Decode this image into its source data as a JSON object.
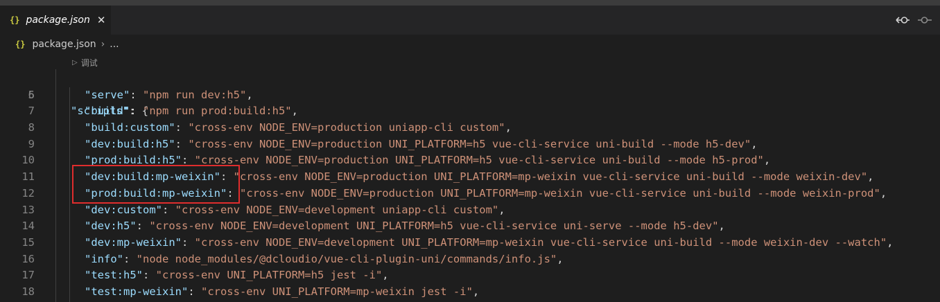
{
  "tab": {
    "icon_text": "{}",
    "title": "package.json",
    "close": "✕"
  },
  "breadcrumb": {
    "icon_text": "{}",
    "file": "package.json",
    "separator": "›",
    "ellipsis": "..."
  },
  "codelens": {
    "arrow": "▷",
    "label": "调试"
  },
  "code": {
    "scripts_line": {
      "number": "5",
      "key": "\"scripts\"",
      "rest": ": {"
    },
    "entries": [
      {
        "number": "6",
        "key": "\"serve\"",
        "value": "\"npm run dev:h5\""
      },
      {
        "number": "7",
        "key": "\"build\"",
        "value": "\"npm run prod:build:h5\""
      },
      {
        "number": "8",
        "key": "\"build:custom\"",
        "value": "\"cross-env NODE_ENV=production uniapp-cli custom\""
      },
      {
        "number": "9",
        "key": "\"dev:build:h5\"",
        "value": "\"cross-env NODE_ENV=production UNI_PLATFORM=h5 vue-cli-service uni-build --mode h5-dev\""
      },
      {
        "number": "10",
        "key": "\"prod:build:h5\"",
        "value": "\"cross-env NODE_ENV=production UNI_PLATFORM=h5 vue-cli-service uni-build --mode h5-prod\""
      },
      {
        "number": "11",
        "key": "\"dev:build:mp-weixin\"",
        "value": "\"cross-env NODE_ENV=production UNI_PLATFORM=mp-weixin vue-cli-service uni-build --mode weixin-dev\""
      },
      {
        "number": "12",
        "key": "\"prod:build:mp-weixin\"",
        "value": "\"cross-env NODE_ENV=production UNI_PLATFORM=mp-weixin vue-cli-service uni-build --mode weixin-prod\""
      },
      {
        "number": "13",
        "key": "\"dev:custom\"",
        "value": "\"cross-env NODE_ENV=development uniapp-cli custom\""
      },
      {
        "number": "14",
        "key": "\"dev:h5\"",
        "value": "\"cross-env NODE_ENV=development UNI_PLATFORM=h5 vue-cli-service uni-serve --mode h5-dev\""
      },
      {
        "number": "15",
        "key": "\"dev:mp-weixin\"",
        "value": "\"cross-env NODE_ENV=development UNI_PLATFORM=mp-weixin vue-cli-service uni-build --mode weixin-dev --watch\""
      },
      {
        "number": "16",
        "key": "\"info\"",
        "value": "\"node node_modules/@dcloudio/vue-cli-plugin-uni/commands/info.js\""
      },
      {
        "number": "17",
        "key": "\"test:h5\"",
        "value": "\"cross-env UNI_PLATFORM=h5 jest -i\""
      },
      {
        "number": "18",
        "key": "\"test:mp-weixin\"",
        "value": "\"cross-env UNI_PLATFORM=mp-weixin jest -i\""
      }
    ]
  },
  "icons": {
    "prev_change": "git-compare-prev-icon",
    "next_change": "git-compare-next-icon"
  },
  "colors": {
    "editor_bg": "#1e1e1e",
    "key": "#9cdcfe",
    "string": "#ce9178",
    "json_icon": "#cbcb41",
    "highlight": "#e02d2d"
  }
}
